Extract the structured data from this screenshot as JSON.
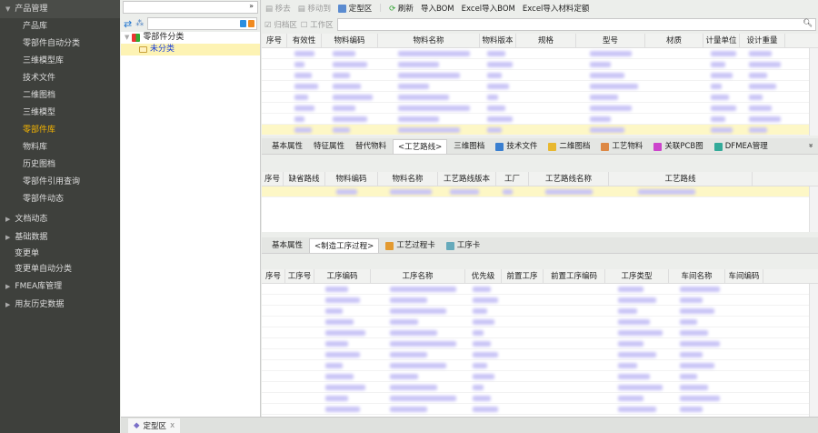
{
  "sidebar": {
    "groups": [
      {
        "label": "产品管理",
        "items": [
          "产品库",
          "零部件自动分类",
          "三维模型库",
          "技术文件",
          "二维图档",
          "三维模型",
          "零部件库",
          "物料库",
          "历史图档",
          "零部件引用查询",
          "零部件动态"
        ],
        "active": "零部件库"
      },
      {
        "label": "文档动态"
      },
      {
        "label": "基础数据",
        "items": [
          "变更单",
          "变更单自动分类"
        ]
      },
      {
        "label": "FMEA库管理"
      },
      {
        "label": "用友历史数据"
      }
    ]
  },
  "tree": {
    "root": "零部件分类",
    "child": "未分类"
  },
  "toolbar": {
    "move_out": "移去",
    "move_to": "移动到",
    "finalize_zone": "定型区",
    "refresh": "刷新",
    "import_bom": "导入BOM",
    "excel_import_bom": "Excel导入BOM",
    "excel_import_quota": "Excel导入材料定额"
  },
  "filter": {
    "archive_zone": "归档区",
    "work_zone": "工作区"
  },
  "parts_grid": {
    "columns": [
      "序号",
      "有效性",
      "物料编码",
      "物料名称",
      "物料版本",
      "规格",
      "型号",
      "材质",
      "计量单位",
      "设计重量"
    ]
  },
  "detail_tabs": [
    "基本属性",
    "特征属性",
    "替代物料",
    "<工艺路线>",
    "三维图档",
    "技术文件",
    "二维图档",
    "工艺物料",
    "关联PCB图",
    "DFMEA管理"
  ],
  "route_grid": {
    "columns": [
      "序号",
      "缺省路线",
      "物料编码",
      "物料名称",
      "工艺路线版本",
      "工厂",
      "工艺路线名称",
      "工艺路线"
    ]
  },
  "process_tabs": [
    "基本属性",
    "<制造工序过程>",
    "工艺过程卡",
    "工序卡"
  ],
  "process_grid": {
    "columns": [
      "序号",
      "工序号",
      "工序编码",
      "工序名称",
      "优先级",
      "前置工序",
      "前置工序编码",
      "工序类型",
      "车间名称",
      "车间编码"
    ]
  },
  "bottom_tab": {
    "label": "定型区",
    "close": "x"
  }
}
